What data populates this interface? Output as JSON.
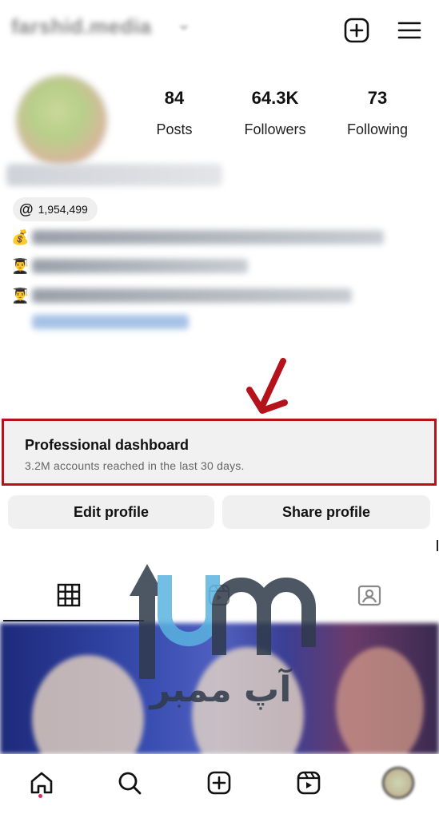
{
  "header": {
    "username": "farshid.media",
    "icons": {
      "add": "plus-square-icon",
      "menu": "hamburger-menu-icon"
    }
  },
  "profile": {
    "stats": [
      {
        "value": "84",
        "label": "Posts"
      },
      {
        "value": "64.3K",
        "label": "Followers"
      },
      {
        "value": "73",
        "label": "Following"
      }
    ],
    "threads_count": "1,954,499",
    "bio_emojis": [
      "💰",
      "👨‍🎓",
      "👨‍🎓"
    ]
  },
  "dashboard": {
    "title": "Professional dashboard",
    "subtitle": "3.2M accounts reached in the last 30 days."
  },
  "buttons": {
    "edit_profile": "Edit profile",
    "share_profile": "Share profile"
  },
  "tabs": [
    "grid-icon",
    "reels-icon",
    "tagged-icon"
  ],
  "watermark": {
    "brand": "upm",
    "text": "آپ ممبر"
  },
  "bottom_nav": [
    "home-icon",
    "search-icon",
    "create-icon",
    "reels-icon",
    "profile-avatar"
  ],
  "colors": {
    "highlight": "#b5121b",
    "notification_dot": "#e0245e"
  }
}
